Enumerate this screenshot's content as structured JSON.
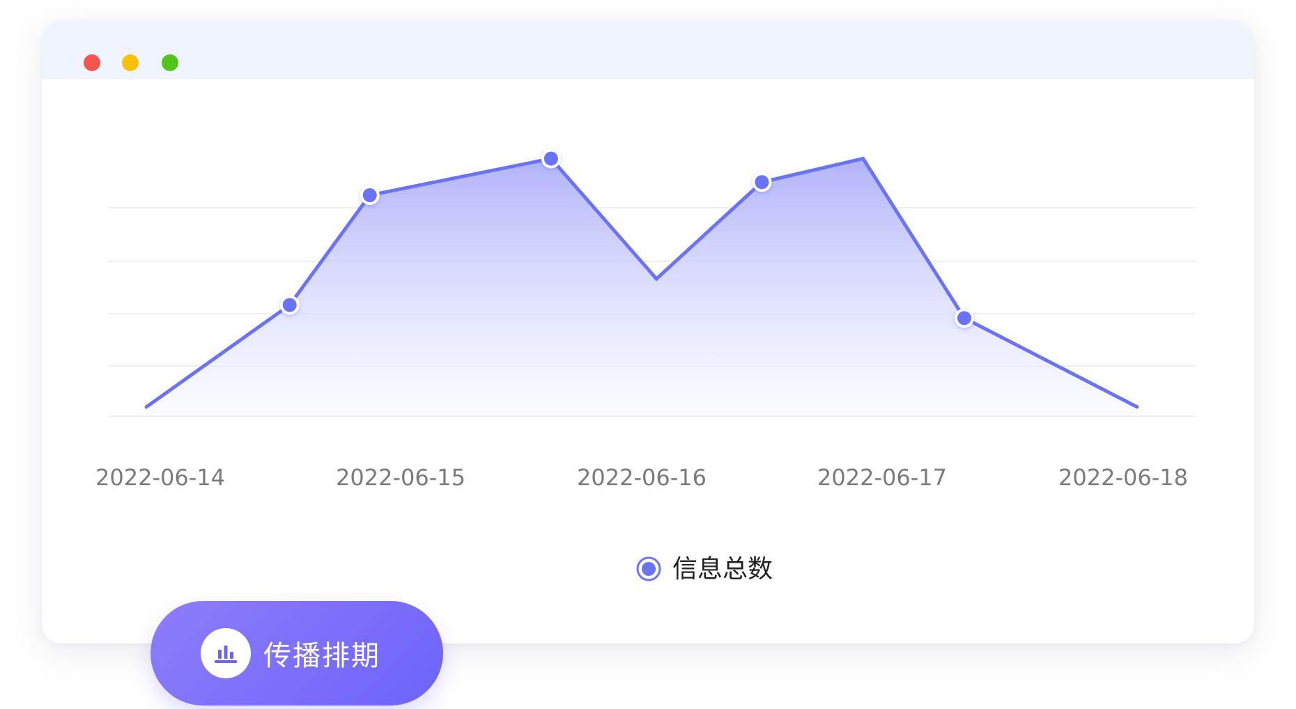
{
  "window": {
    "traffic_lights": [
      {
        "name": "close",
        "color": "#f4564f"
      },
      {
        "name": "minimize",
        "color": "#f7c10a"
      },
      {
        "name": "maximize",
        "color": "#52c41a"
      }
    ]
  },
  "chart_data": {
    "type": "area",
    "title": "",
    "xlabel": "",
    "ylabel": "",
    "categories": [
      "2022-06-14",
      "2022-06-15",
      "2022-06-16",
      "2022-06-17",
      "2022-06-18"
    ],
    "x": [
      0.0,
      0.68,
      1.06,
      1.92,
      2.42,
      2.92,
      3.4,
      3.88,
      4.7
    ],
    "series": [
      {
        "name": "信息总数",
        "values": [
          0.15,
          2.1,
          4.2,
          4.9,
          2.6,
          4.45,
          4.9,
          1.85,
          0.15
        ],
        "marker": [
          false,
          true,
          true,
          true,
          false,
          true,
          false,
          true,
          false
        ]
      }
    ],
    "ylim": [
      0,
      5
    ],
    "grid": true,
    "legend": "bottom-center",
    "colors": {
      "line": "#6a72f6",
      "area_top": "#b1b3fa",
      "area_bottom": "#f8f9ff",
      "grid": "#eeeeee",
      "tick_text": "#7a7a7a"
    }
  },
  "badge": {
    "label": "传播排期",
    "icon": "bar-chart-icon",
    "gradient": [
      "#8e7dfb",
      "#6c63f9"
    ]
  }
}
